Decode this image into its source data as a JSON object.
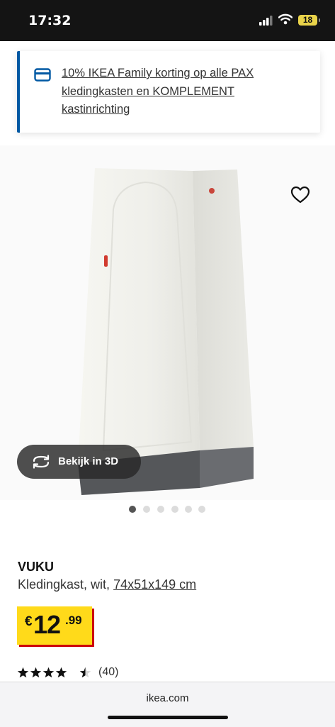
{
  "status_bar": {
    "time": "17:32",
    "battery": "18"
  },
  "promo": {
    "text": "10% IKEA Family korting op alle PAX kledingkasten en KOMPLEMENT kastinrichting"
  },
  "gallery": {
    "view_3d_label": "Bekijk in 3D",
    "image_count": 6,
    "active_index": 0
  },
  "product": {
    "name": "VUKU",
    "description": "Kledingkast, wit,",
    "dimensions": "74x51x149 cm",
    "price": {
      "currency": "€",
      "integer": "12",
      "decimal": ".99"
    },
    "rating": {
      "stars": 4.5,
      "count": "(40)"
    }
  },
  "browser": {
    "url": "ikea.com"
  },
  "colors": {
    "accent": "#0058a3",
    "price_bg": "#ffda1a",
    "price_shadow": "#cc0008"
  }
}
